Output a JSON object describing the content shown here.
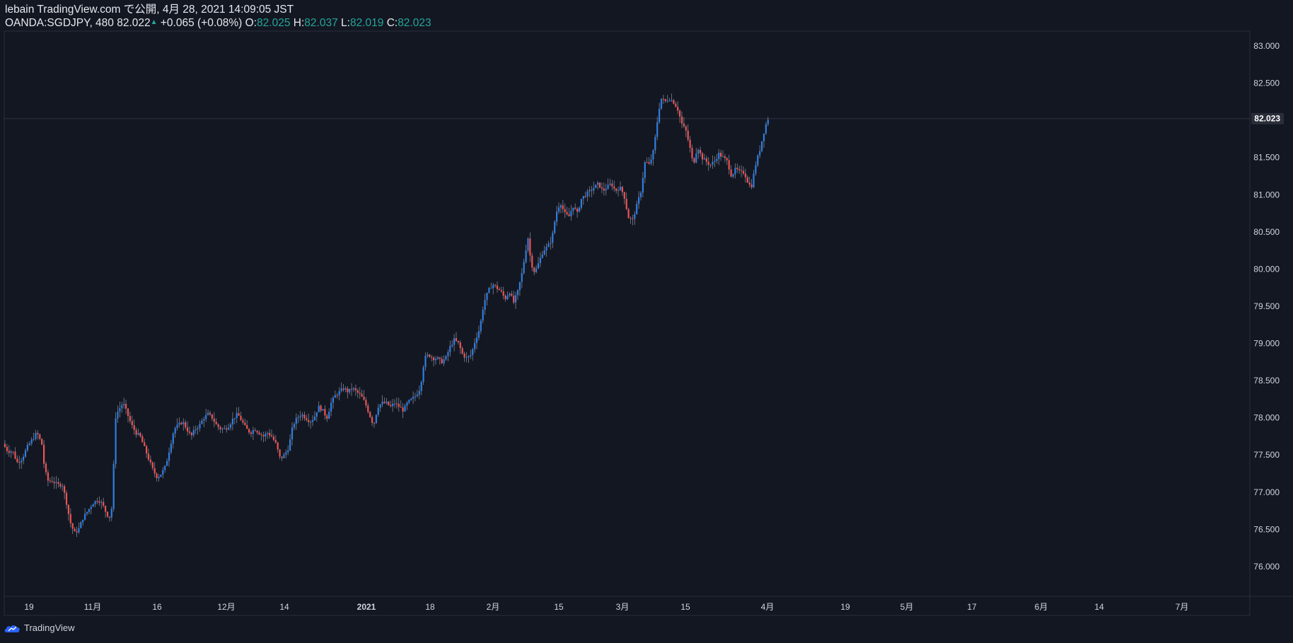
{
  "header": {
    "published": "lebain TradingView.com で公開, 4月 28, 2021 14:09:05 JST",
    "symbol": "OANDA:SGDJPY, 480",
    "last": "82.022",
    "change": "+0.065 (+0.08%)",
    "o_label": "O:",
    "o_value": "82.025",
    "h_label": "H:",
    "h_value": "82.037",
    "l_label": "L:",
    "l_value": "82.019",
    "c_label": "C:",
    "c_value": "82.023"
  },
  "footer": {
    "brand": "TradingView"
  },
  "colors": {
    "background": "#131722",
    "up": "#2f7ee0",
    "down": "#ef5350",
    "wick": "#7c8396",
    "axis_text": "#d1d4dc",
    "grid_line": "#2a2e39"
  },
  "chart_data": {
    "type": "candlestick",
    "symbol": "OANDA:SGDJPY",
    "interval": "480",
    "ylim": [
      75.6,
      83.2
    ],
    "y_ticks": [
      "83.000",
      "82.500",
      "82.000",
      "81.500",
      "81.000",
      "80.500",
      "80.000",
      "79.500",
      "79.000",
      "78.500",
      "78.000",
      "77.500",
      "77.000",
      "76.500",
      "76.000"
    ],
    "x_ticks": [
      "19",
      "11月",
      "16",
      "12月",
      "14",
      "2021",
      "18",
      "2月",
      "15",
      "3月",
      "15",
      "4月",
      "19",
      "5月",
      "17",
      "6月",
      "14",
      "7月"
    ],
    "last_price_label": "82.023",
    "last_price": 82.023,
    "series_points": [
      [
        0,
        77.65
      ],
      [
        7,
        77.55
      ],
      [
        14,
        77.55
      ],
      [
        20,
        77.4
      ],
      [
        27,
        77.45
      ],
      [
        34,
        77.6
      ],
      [
        41,
        77.7
      ],
      [
        48,
        77.8
      ],
      [
        55,
        77.65
      ],
      [
        59,
        77.3
      ],
      [
        64,
        77.15
      ],
      [
        70,
        77.15
      ],
      [
        77,
        77.1
      ],
      [
        84,
        77.1
      ],
      [
        89,
        76.9
      ],
      [
        95,
        76.6
      ],
      [
        101,
        76.45
      ],
      [
        107,
        76.5
      ],
      [
        113,
        76.65
      ],
      [
        120,
        76.75
      ],
      [
        127,
        76.85
      ],
      [
        134,
        76.9
      ],
      [
        140,
        76.85
      ],
      [
        147,
        76.7
      ],
      [
        153,
        76.65
      ],
      [
        156,
        77.2
      ],
      [
        159,
        78.0
      ],
      [
        163,
        78.1
      ],
      [
        170,
        78.2
      ],
      [
        176,
        78.05
      ],
      [
        182,
        77.9
      ],
      [
        188,
        77.8
      ],
      [
        194,
        77.75
      ],
      [
        200,
        77.6
      ],
      [
        206,
        77.45
      ],
      [
        212,
        77.3
      ],
      [
        218,
        77.2
      ],
      [
        224,
        77.25
      ],
      [
        230,
        77.35
      ],
      [
        236,
        77.6
      ],
      [
        242,
        77.85
      ],
      [
        248,
        77.9
      ],
      [
        254,
        77.95
      ],
      [
        260,
        77.85
      ],
      [
        266,
        77.75
      ],
      [
        272,
        77.85
      ],
      [
        278,
        77.9
      ],
      [
        284,
        78.0
      ],
      [
        290,
        78.05
      ],
      [
        296,
        78.0
      ],
      [
        302,
        77.9
      ],
      [
        308,
        77.85
      ],
      [
        314,
        77.85
      ],
      [
        320,
        77.9
      ],
      [
        326,
        78.0
      ],
      [
        332,
        78.05
      ],
      [
        338,
        77.95
      ],
      [
        344,
        77.85
      ],
      [
        350,
        77.8
      ],
      [
        356,
        77.85
      ],
      [
        362,
        77.8
      ],
      [
        368,
        77.75
      ],
      [
        374,
        77.8
      ],
      [
        380,
        77.75
      ],
      [
        386,
        77.65
      ],
      [
        392,
        77.45
      ],
      [
        398,
        77.5
      ],
      [
        404,
        77.6
      ],
      [
        410,
        77.9
      ],
      [
        416,
        78.0
      ],
      [
        422,
        78.05
      ],
      [
        428,
        78.0
      ],
      [
        434,
        77.95
      ],
      [
        440,
        78.0
      ],
      [
        446,
        78.15
      ],
      [
        452,
        78.1
      ],
      [
        458,
        78.0
      ],
      [
        464,
        78.2
      ],
      [
        470,
        78.3
      ],
      [
        476,
        78.35
      ],
      [
        482,
        78.4
      ],
      [
        488,
        78.35
      ],
      [
        494,
        78.4
      ],
      [
        500,
        78.35
      ],
      [
        506,
        78.3
      ],
      [
        512,
        78.2
      ],
      [
        518,
        78.05
      ],
      [
        524,
        77.9
      ],
      [
        530,
        78.15
      ],
      [
        536,
        78.2
      ],
      [
        542,
        78.2
      ],
      [
        548,
        78.15
      ],
      [
        554,
        78.2
      ],
      [
        560,
        78.15
      ],
      [
        566,
        78.1
      ],
      [
        572,
        78.2
      ],
      [
        578,
        78.25
      ],
      [
        584,
        78.3
      ],
      [
        590,
        78.4
      ],
      [
        596,
        78.8
      ],
      [
        602,
        78.85
      ],
      [
        608,
        78.8
      ],
      [
        614,
        78.8
      ],
      [
        620,
        78.75
      ],
      [
        626,
        78.8
      ],
      [
        632,
        78.95
      ],
      [
        638,
        79.05
      ],
      [
        644,
        79.0
      ],
      [
        650,
        78.85
      ],
      [
        656,
        78.8
      ],
      [
        662,
        78.85
      ],
      [
        668,
        79.05
      ],
      [
        674,
        79.2
      ],
      [
        680,
        79.55
      ],
      [
        686,
        79.7
      ],
      [
        692,
        79.8
      ],
      [
        698,
        79.75
      ],
      [
        704,
        79.7
      ],
      [
        710,
        79.6
      ],
      [
        716,
        79.7
      ],
      [
        722,
        79.55
      ],
      [
        728,
        79.7
      ],
      [
        734,
        79.95
      ],
      [
        740,
        80.3
      ],
      [
        743,
        80.45
      ],
      [
        746,
        80.1
      ],
      [
        752,
        79.95
      ],
      [
        758,
        80.1
      ],
      [
        764,
        80.25
      ],
      [
        770,
        80.3
      ],
      [
        776,
        80.4
      ],
      [
        782,
        80.75
      ],
      [
        788,
        80.9
      ],
      [
        794,
        80.75
      ],
      [
        800,
        80.7
      ],
      [
        806,
        80.85
      ],
      [
        812,
        80.75
      ],
      [
        818,
        80.95
      ],
      [
        824,
        81.0
      ],
      [
        830,
        81.05
      ],
      [
        836,
        81.1
      ],
      [
        842,
        81.15
      ],
      [
        848,
        81.05
      ],
      [
        854,
        81.1
      ],
      [
        860,
        81.15
      ],
      [
        866,
        81.05
      ],
      [
        872,
        81.1
      ],
      [
        878,
        81.0
      ],
      [
        884,
        80.7
      ],
      [
        890,
        80.65
      ],
      [
        896,
        80.85
      ],
      [
        902,
        81.05
      ],
      [
        908,
        81.45
      ],
      [
        914,
        81.4
      ],
      [
        920,
        81.6
      ],
      [
        926,
        82.05
      ],
      [
        930,
        82.3
      ],
      [
        936,
        82.25
      ],
      [
        942,
        82.3
      ],
      [
        948,
        82.25
      ],
      [
        954,
        82.15
      ],
      [
        960,
        81.95
      ],
      [
        966,
        81.85
      ],
      [
        972,
        81.6
      ],
      [
        976,
        81.4
      ],
      [
        982,
        81.65
      ],
      [
        988,
        81.5
      ],
      [
        994,
        81.45
      ],
      [
        1000,
        81.4
      ],
      [
        1006,
        81.45
      ],
      [
        1012,
        81.55
      ],
      [
        1018,
        81.5
      ],
      [
        1024,
        81.45
      ],
      [
        1030,
        81.25
      ],
      [
        1036,
        81.35
      ],
      [
        1042,
        81.3
      ],
      [
        1048,
        81.3
      ],
      [
        1054,
        81.15
      ],
      [
        1058,
        81.1
      ],
      [
        1064,
        81.4
      ],
      [
        1070,
        81.6
      ],
      [
        1076,
        81.85
      ],
      [
        1081,
        82.023
      ]
    ]
  }
}
